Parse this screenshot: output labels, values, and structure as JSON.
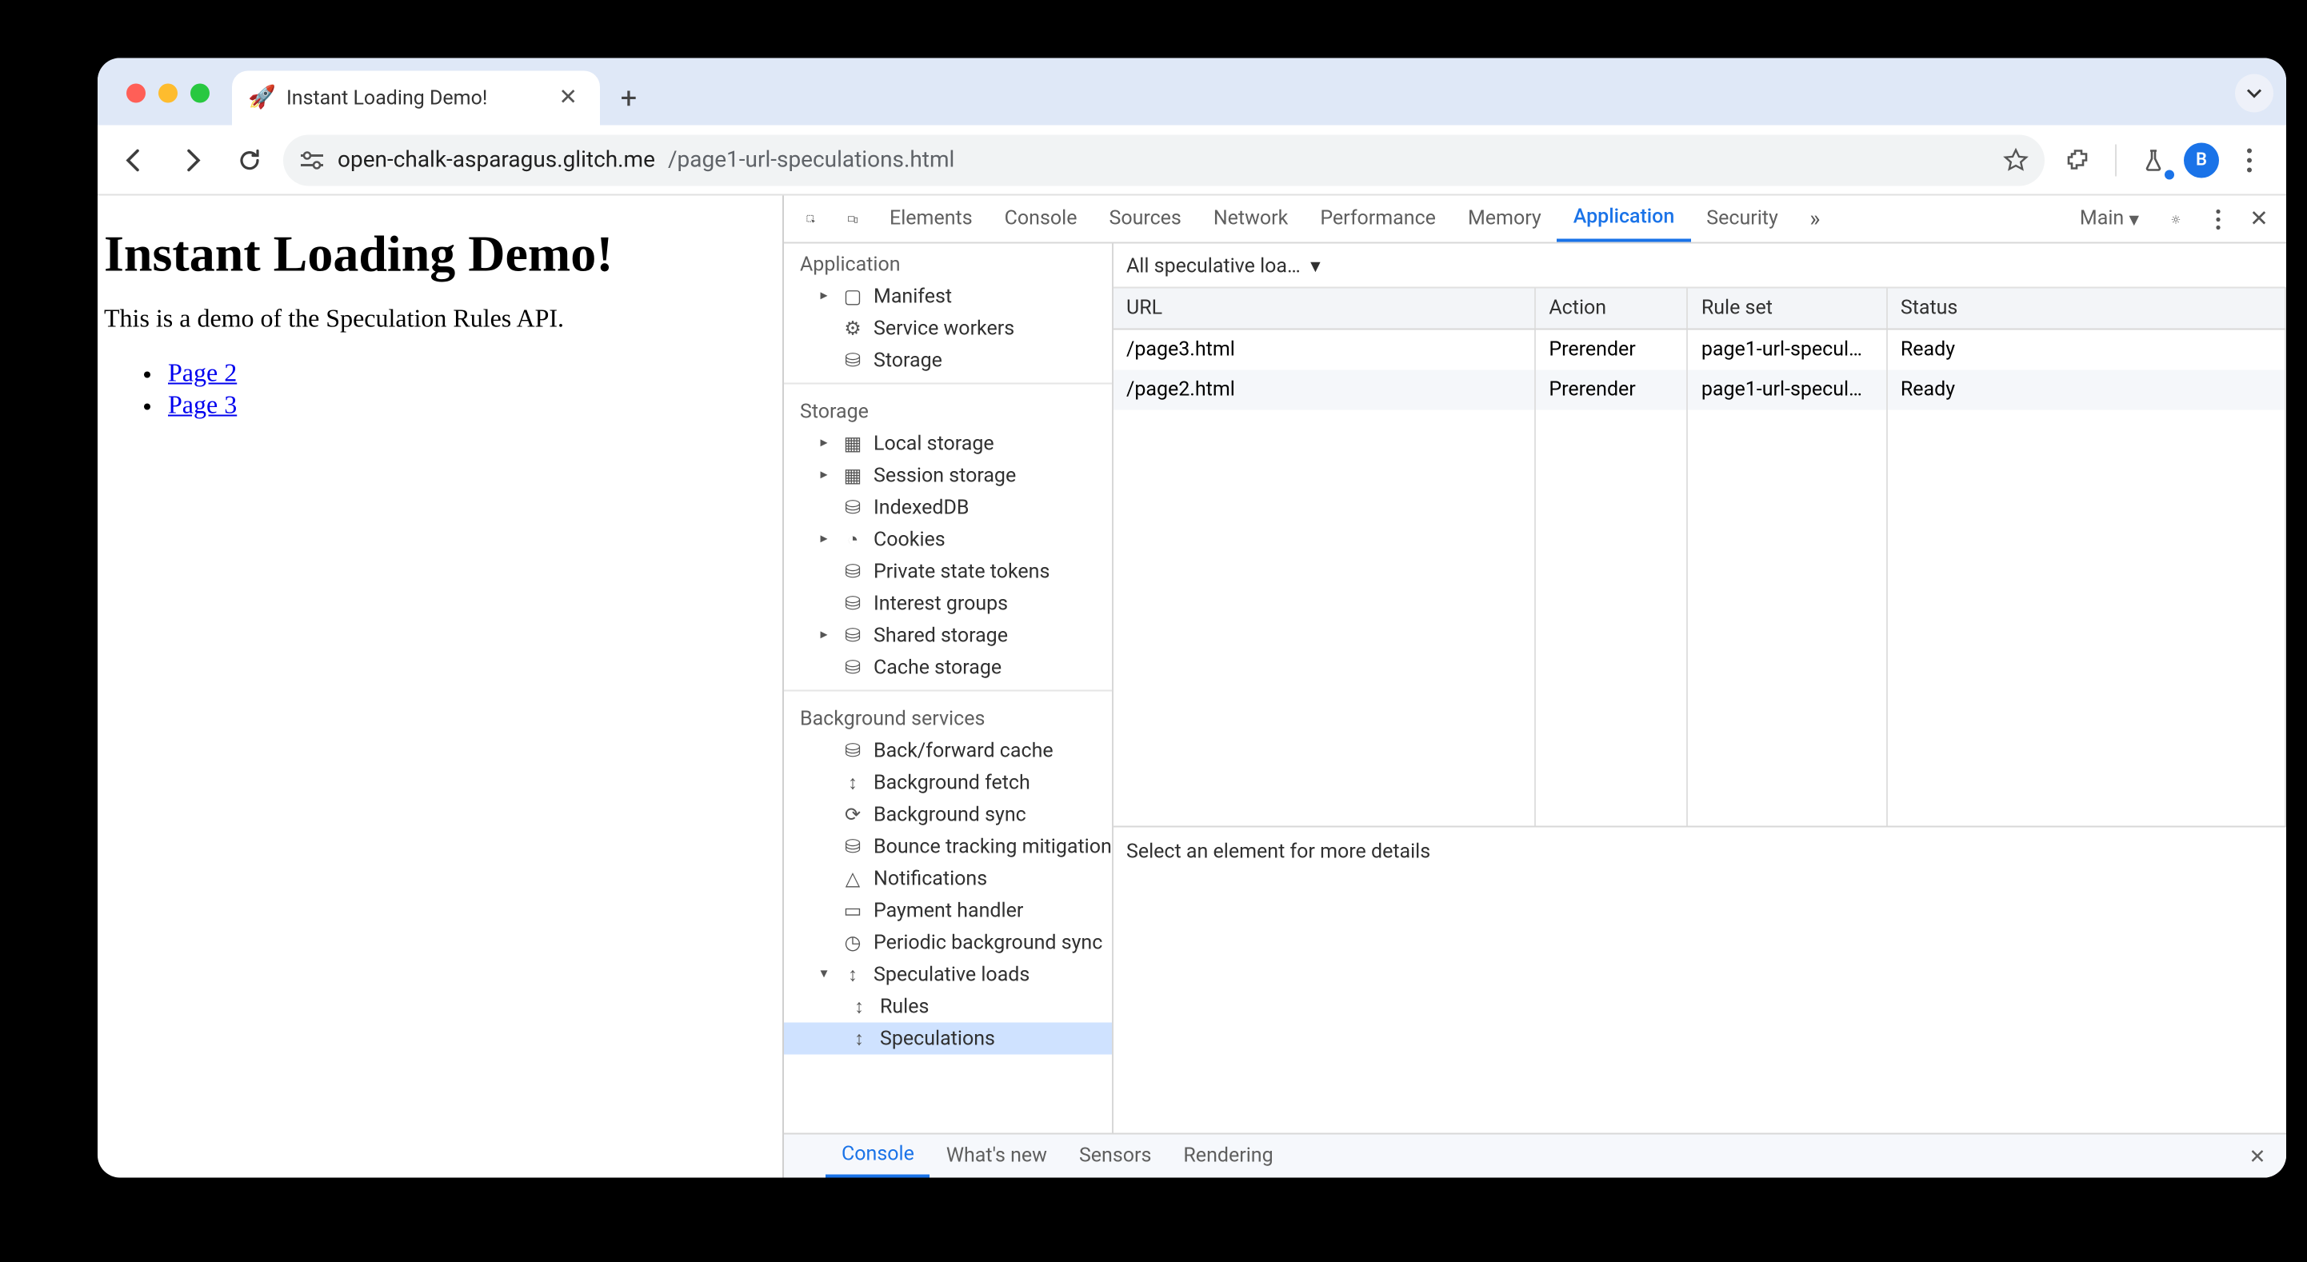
{
  "browser": {
    "tab_title": "Instant Loading Demo!",
    "favicon": "🚀",
    "url_host": "open-chalk-asparagus.glitch.me",
    "url_path": "/page1-url-speculations.html",
    "avatar_letter": "B"
  },
  "page": {
    "heading": "Instant Loading Demo!",
    "intro": "This is a demo of the Speculation Rules API.",
    "links": [
      "Page 2",
      "Page 3"
    ]
  },
  "devtools": {
    "tabs": [
      "Elements",
      "Console",
      "Sources",
      "Network",
      "Performance",
      "Memory",
      "Application",
      "Security"
    ],
    "active_tab": "Application",
    "target_label": "Main",
    "side": {
      "application": {
        "label": "Application",
        "items": [
          {
            "label": "Manifest",
            "icon": "file",
            "expandable": true
          },
          {
            "label": "Service workers",
            "icon": "gears"
          },
          {
            "label": "Storage",
            "icon": "db"
          }
        ]
      },
      "storage": {
        "label": "Storage",
        "items": [
          {
            "label": "Local storage",
            "icon": "grid",
            "expandable": true
          },
          {
            "label": "Session storage",
            "icon": "grid",
            "expandable": true
          },
          {
            "label": "IndexedDB",
            "icon": "db"
          },
          {
            "label": "Cookies",
            "icon": "cookie",
            "expandable": true
          },
          {
            "label": "Private state tokens",
            "icon": "db"
          },
          {
            "label": "Interest groups",
            "icon": "db"
          },
          {
            "label": "Shared storage",
            "icon": "db",
            "expandable": true
          },
          {
            "label": "Cache storage",
            "icon": "db"
          }
        ]
      },
      "background": {
        "label": "Background services",
        "items": [
          {
            "label": "Back/forward cache",
            "icon": "db"
          },
          {
            "label": "Background fetch",
            "icon": "sync"
          },
          {
            "label": "Background sync",
            "icon": "sync"
          },
          {
            "label": "Bounce tracking mitigation",
            "icon": "db"
          },
          {
            "label": "Notifications",
            "icon": "bell"
          },
          {
            "label": "Payment handler",
            "icon": "card"
          },
          {
            "label": "Periodic background sync",
            "icon": "clock"
          },
          {
            "label": "Speculative loads",
            "icon": "sync",
            "expandable": true,
            "expanded": true,
            "children": [
              {
                "label": "Rules",
                "icon": "sync"
              },
              {
                "label": "Speculations",
                "icon": "sync",
                "selected": true
              }
            ]
          }
        ]
      }
    },
    "filter_label": "All speculative loa…",
    "columns": [
      "URL",
      "Action",
      "Rule set",
      "Status"
    ],
    "col_widths": [
      "36%",
      "13%",
      "17%",
      "34%"
    ],
    "rows": [
      {
        "url": "/page3.html",
        "action": "Prerender",
        "ruleset": "page1-url-specul…",
        "status": "Ready"
      },
      {
        "url": "/page2.html",
        "action": "Prerender",
        "ruleset": "page1-url-specul…",
        "status": "Ready"
      }
    ],
    "detail_placeholder": "Select an element for more details",
    "drawer_tabs": [
      "Console",
      "What's new",
      "Sensors",
      "Rendering"
    ],
    "drawer_active": "Console"
  }
}
